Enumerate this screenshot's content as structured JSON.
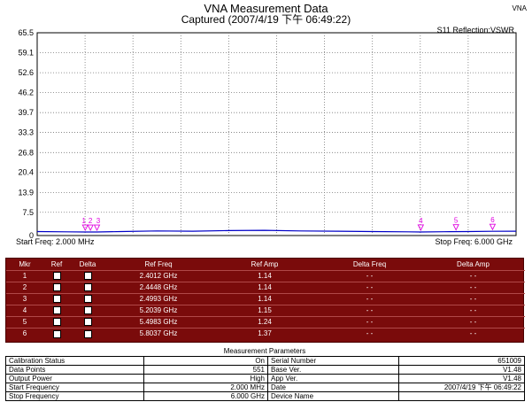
{
  "header": {
    "title": "VNA Measurement Data",
    "subtitle": "Captured (2007/4/19 下午 06:49:22)",
    "app_tag": "VNA",
    "trace_label": "S11 Reflection:VSWR"
  },
  "chart_data": {
    "type": "line",
    "ylim": [
      0,
      65.5
    ],
    "xlim": [
      2.0,
      6.0
    ],
    "x_unit": "GHz",
    "yticks": [
      "65.5",
      "59.1",
      "52.6",
      "46.2",
      "39.7",
      "33.3",
      "26.8",
      "20.4",
      "13.9",
      "7.5",
      "0"
    ],
    "ytick_values": [
      65.5,
      59.1,
      52.6,
      46.2,
      39.7,
      33.3,
      26.8,
      20.4,
      13.9,
      7.5,
      0
    ],
    "x_divisions": 10,
    "grid": true,
    "start_label": "Start Freq: 2.000 MHz",
    "stop_label": "Stop Freq: 6.000 GHz",
    "series": [
      {
        "color": "#0000c8",
        "x": [
          2.0,
          2.25,
          2.4,
          2.5,
          2.7,
          3.0,
          3.3,
          3.6,
          3.9,
          4.2,
          4.5,
          4.8,
          5.1,
          5.2,
          5.4,
          5.6,
          5.8,
          6.0
        ],
        "y": [
          1.3,
          1.2,
          1.14,
          1.14,
          1.3,
          1.5,
          1.4,
          1.6,
          1.7,
          1.5,
          1.4,
          1.3,
          1.2,
          1.15,
          1.24,
          1.3,
          1.37,
          1.4
        ]
      }
    ],
    "markers": [
      {
        "label": "1",
        "x": 2.4012,
        "y": 1.14
      },
      {
        "label": "2",
        "x": 2.4448,
        "y": 1.14
      },
      {
        "label": "3",
        "x": 2.4993,
        "y": 1.14
      },
      {
        "label": "4",
        "x": 5.2039,
        "y": 1.15
      },
      {
        "label": "5",
        "x": 5.4983,
        "y": 1.24
      },
      {
        "label": "6",
        "x": 5.8037,
        "y": 1.37
      }
    ],
    "marker_color": "#e000e0"
  },
  "marker_table": {
    "headers": [
      "Mkr",
      "Ref",
      "Delta",
      "Ref Freq",
      "Ref Amp",
      "Delta Freq",
      "Delta Amp"
    ],
    "rows": [
      {
        "mkr": "1",
        "ref_freq": "2.4012 GHz",
        "ref_amp": "1.14",
        "delta_freq": "- -",
        "delta_amp": "- -"
      },
      {
        "mkr": "2",
        "ref_freq": "2.4448 GHz",
        "ref_amp": "1.14",
        "delta_freq": "- -",
        "delta_amp": "- -"
      },
      {
        "mkr": "3",
        "ref_freq": "2.4993 GHz",
        "ref_amp": "1.14",
        "delta_freq": "- -",
        "delta_amp": "- -"
      },
      {
        "mkr": "4",
        "ref_freq": "5.2039 GHz",
        "ref_amp": "1.15",
        "delta_freq": "- -",
        "delta_amp": "- -"
      },
      {
        "mkr": "5",
        "ref_freq": "5.4983 GHz",
        "ref_amp": "1.24",
        "delta_freq": "- -",
        "delta_amp": "- -"
      },
      {
        "mkr": "6",
        "ref_freq": "5.8037 GHz",
        "ref_amp": "1.37",
        "delta_freq": "- -",
        "delta_amp": "- -"
      }
    ]
  },
  "params": {
    "title": "Measurement Parameters",
    "rows": [
      [
        "Calibration Status",
        "On",
        "Serial Number",
        "651009"
      ],
      [
        "Data Points",
        "551",
        "Base Ver.",
        "V1.48"
      ],
      [
        "Output Power",
        "High",
        "App Ver.",
        "V1.48"
      ],
      [
        "Start Frequency",
        "2.000 MHz",
        "Date",
        "2007/4/19 下午 06:49:22"
      ],
      [
        "Stop Frequency",
        "6.000 GHz",
        "Device Name",
        ""
      ]
    ]
  }
}
